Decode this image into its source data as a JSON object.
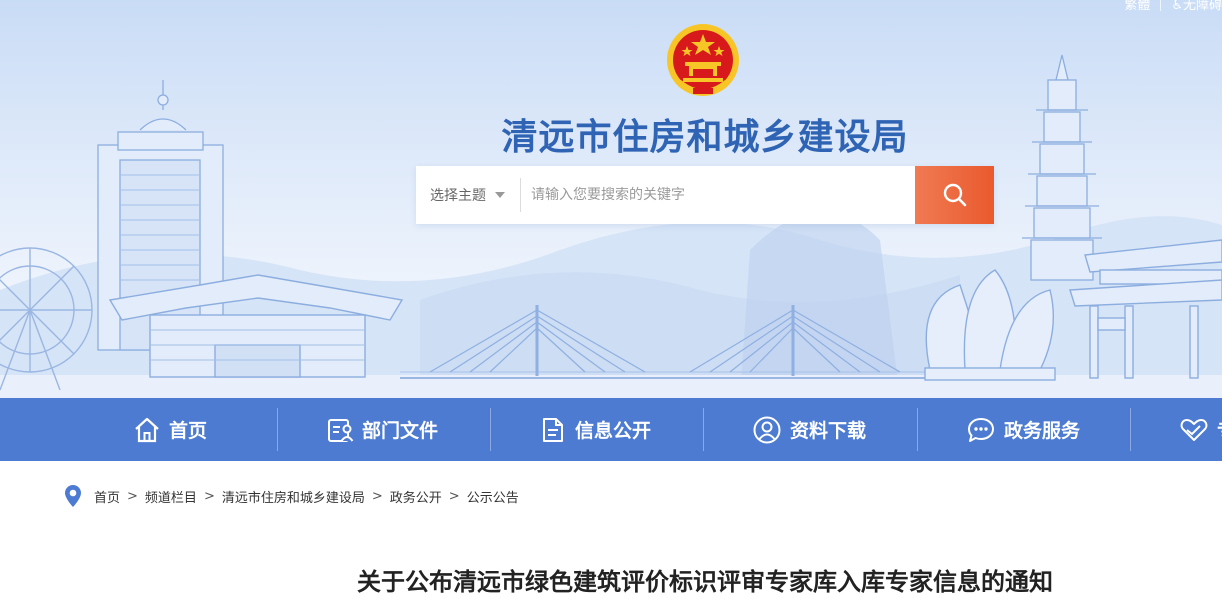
{
  "header": {
    "top_links": [
      "繁體",
      "无障碍"
    ],
    "site_title": "清远市住房和城乡建设局"
  },
  "search": {
    "topic_label": "选择主题",
    "placeholder": "请输入您要搜索的关键字",
    "value": ""
  },
  "nav": {
    "items": [
      {
        "label": "首页",
        "icon": "home-icon"
      },
      {
        "label": "部门文件",
        "icon": "document-user-icon"
      },
      {
        "label": "信息公开",
        "icon": "file-icon"
      },
      {
        "label": "资料下载",
        "icon": "user-circle-icon"
      },
      {
        "label": "政务服务",
        "icon": "chat-bubble-icon"
      },
      {
        "label": "专",
        "icon": "heart-hand-icon"
      }
    ]
  },
  "breadcrumb": [
    "首页",
    "频道栏目",
    "清远市住房和城乡建设局",
    "政务公开",
    "公示公告"
  ],
  "article": {
    "title": "关于公布清远市绿色建筑评价标识评审专家库入库专家信息的通知"
  },
  "colors": {
    "nav_bg": "#4c7bd1",
    "title_blue": "#2f64b4",
    "search_button": "#ea5a2e",
    "emblem_red": "#d7191c",
    "emblem_gold": "#f7c626"
  }
}
